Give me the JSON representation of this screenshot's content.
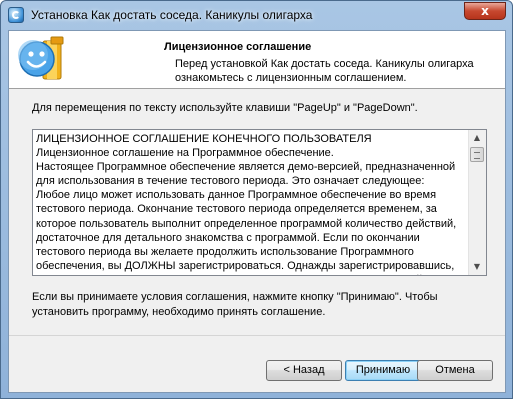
{
  "window": {
    "title": "Установка Как достать соседа. Каникулы олигарха",
    "close_label": "x"
  },
  "header": {
    "title": "Лицензионное соглашение",
    "subtitle": "Перед установкой Как достать соседа. Каникулы олигарха ознакомьтесь с лицензионным соглашением."
  },
  "hint": "Для перемещения по тексту используйте клавиши \"PageUp\" и \"PageDown\".",
  "license": {
    "text": "ЛИЦЕНЗИОННОЕ СОГЛАШЕНИЕ КОНЕЧНОГО ПОЛЬЗОВАТЕЛЯ\nЛицензионное соглашение на Программное обеспечение.\nНастоящее Программное обеспечение является демо-версией, предназначенной для использования в течение тестового периода. Это означает следующее:\nЛюбое лицо может использовать данное Программное обеспечение во время тестового периода. Окончание тестового периода определяется временем, за которое пользователь выполнит определенное программой количество действий, достаточное для детального знакомства с программой. Если по окончании тестового периода вы желаете продолжить использование Программного обеспечения, вы ДОЛЖНЫ зарегистрироваться. Однажды зарегистрировавшись, пользователь получает неисключительное право на использование данной"
  },
  "accept_text": "Если вы принимаете условия соглашения, нажмите кнопку \"Принимаю\". Чтобы установить программу, необходимо принять соглашение.",
  "buttons": {
    "back": "< Назад",
    "accept": "Принимаю",
    "cancel": "Отмена"
  },
  "icons": {
    "app": "installer-app-icon",
    "logo": "smiley-box-logo",
    "close": "close-icon",
    "scroll_up": "arrow-up-icon",
    "scroll_down": "arrow-down-icon"
  }
}
